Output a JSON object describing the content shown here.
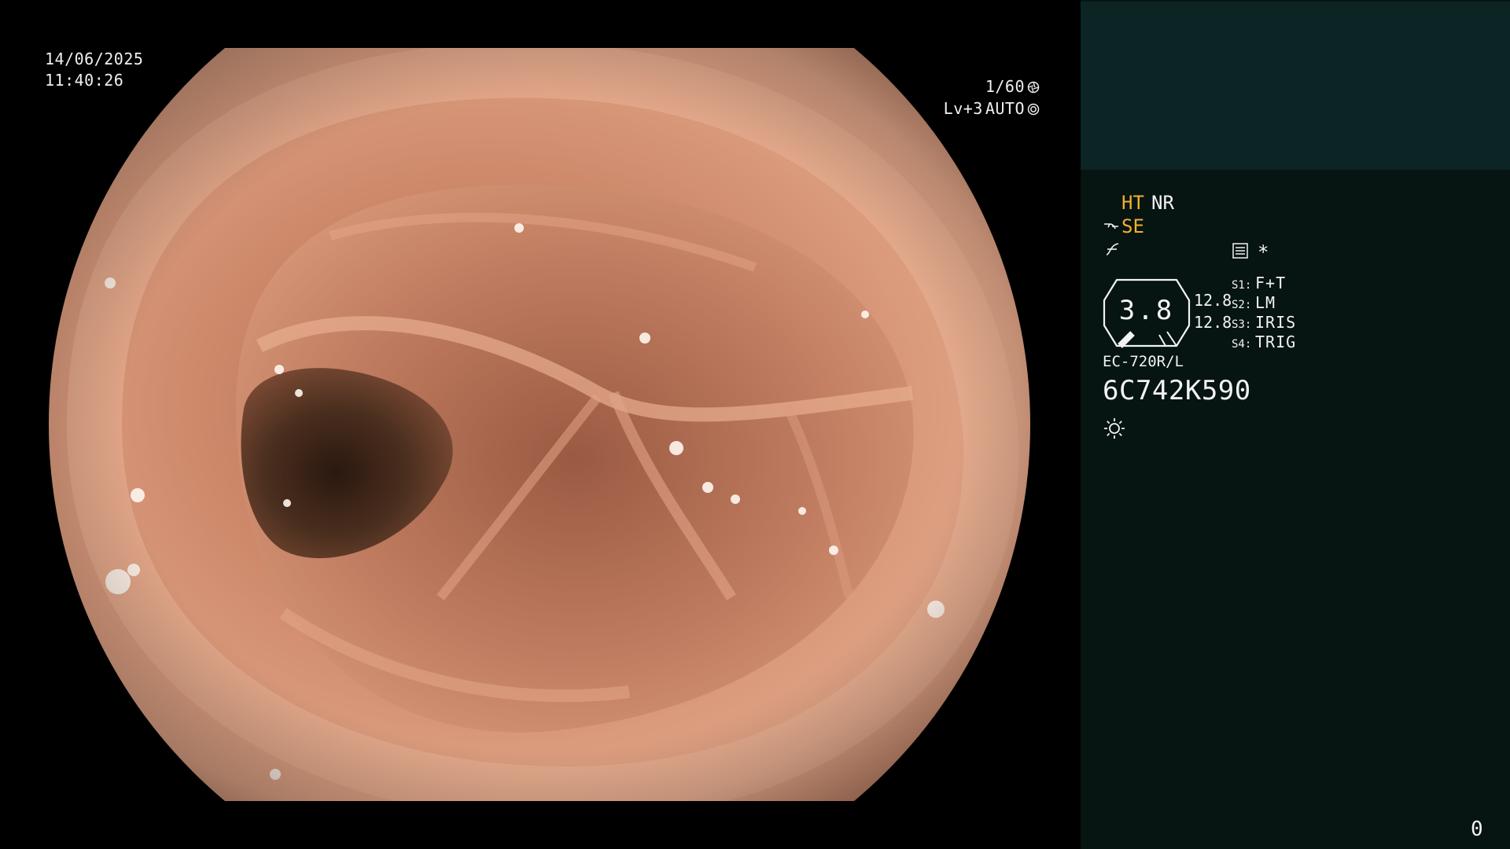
{
  "osd": {
    "date": "14/06/2025",
    "time": "11:40:26",
    "shutter": "1/60",
    "shutter_icon": "shutter-icon",
    "level": "Lv+3",
    "iris_mode": "AUTO",
    "iris_icon": "auto-iris-icon"
  },
  "panel": {
    "ht_label": "HT",
    "nr_label": "NR",
    "se_label": "SE",
    "se_icon": "structure-enhance-icon",
    "curve_icon": "tone-curve-icon",
    "menu_icon": "menu-icon",
    "star_label": "*",
    "gauge_value": "3.8",
    "gauge_icon": "zoom-gauge-icon",
    "magnification": [
      "12.8",
      "12.8"
    ],
    "switches": [
      {
        "key": "S1:",
        "value": "F+T"
      },
      {
        "key": "S2:",
        "value": "LM"
      },
      {
        "key": "S3:",
        "value": "IRIS"
      },
      {
        "key": "S4:",
        "value": "TRIG"
      }
    ],
    "scope_model": "EC-720R/L",
    "scope_serial": "6C742K590",
    "light_icon": "light-source-icon",
    "frame_count": "0"
  },
  "colors": {
    "background": "#000000",
    "panel_bg": "#061412",
    "thumb_bg": "#0c2424",
    "accent": "#f0b030",
    "mucosa": "#d9987a",
    "lumen": "#3a2418"
  }
}
